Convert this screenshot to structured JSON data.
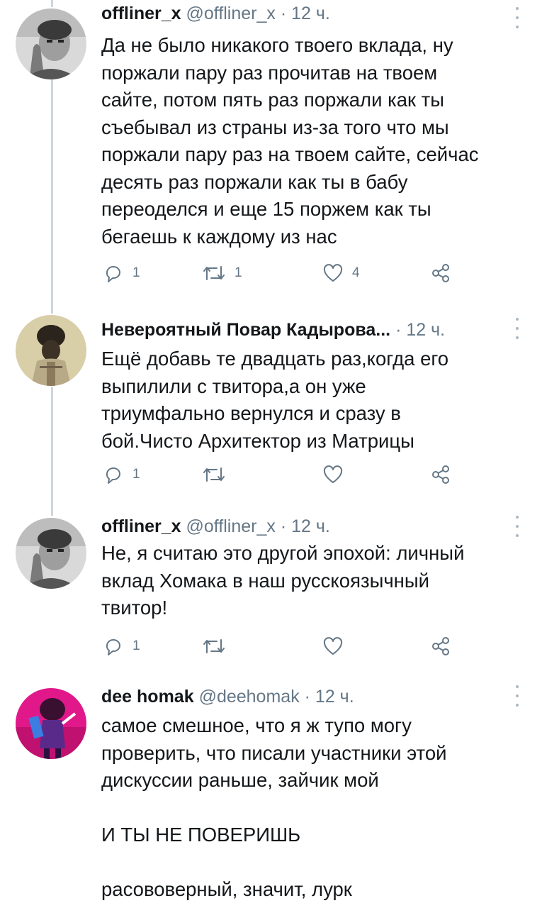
{
  "tweets": [
    {
      "name": "offliner_x",
      "handle": "@offliner_x",
      "time": "· 12 ч.",
      "text": "Да не было никакого твоего вклада, ну\nпоржали пару раз прочитав на твоем\nсайте, потом пять раз поржали как ты\nсъебывал из страны из-за того что мы\nпоржали пару раз на твоем сайте, сейчас\nдесять раз поржали как ты в бабу\nпереоделся и еще 15 поржем как ты\nбегаешь к каждому из нас",
      "replies": "1",
      "retweets": "1",
      "likes": "4"
    },
    {
      "name": "Невероятный Повар Кадырова...",
      "handle": "",
      "time": "· 12 ч.",
      "text": "Ещё добавь те двадцать раз,когда его\nвыпилили с твитора,а он уже\nтриумфально вернулся и сразу в\nбой.Чисто Архитектор из Матрицы",
      "replies": "1",
      "retweets": "",
      "likes": ""
    },
    {
      "name": "offliner_x",
      "handle": "@offliner_x",
      "time": "· 12 ч.",
      "text": "Не, я считаю это другой эпохой: личный\nвклад Хомака в наш русскоязычный\nтвитор!",
      "replies": "1",
      "retweets": "",
      "likes": ""
    },
    {
      "name": "dee homak",
      "handle": "@deehomak",
      "time": "· 12 ч.",
      "text": "самое смешное, что я ж тупо могу\nпроверить, что писали участники этой\nдискуссии раньше, зайчик мой\n\nИ ТЫ НЕ ПОВЕРИШЬ\n\nрасововерный, значит, лурк",
      "replies": "",
      "retweets": "",
      "likes": ""
    }
  ]
}
